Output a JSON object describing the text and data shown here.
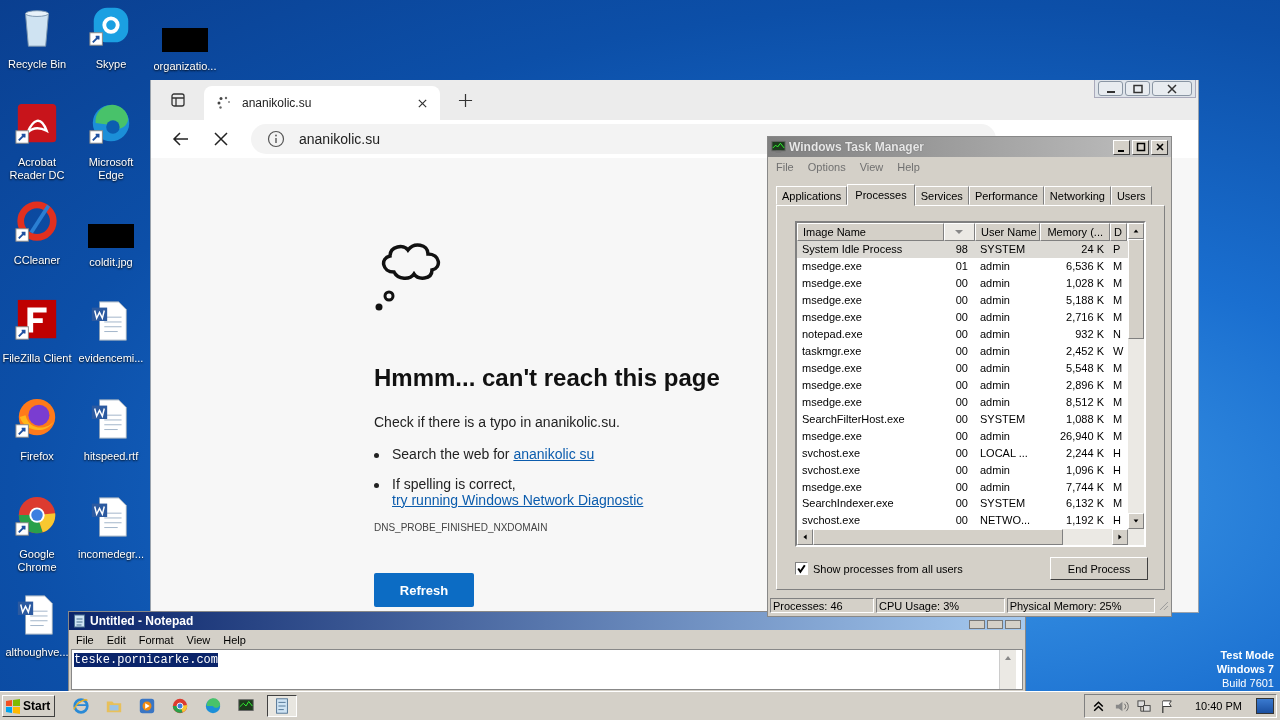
{
  "desktop": {
    "icon_columns": [
      [
        {
          "label": "Recycle Bin",
          "kind": "recycle",
          "shortcut": false
        },
        {
          "label": "Acrobat Reader DC",
          "kind": "acrobat",
          "shortcut": true
        },
        {
          "label": "CCleaner",
          "kind": "ccleaner",
          "shortcut": true
        },
        {
          "label": "FileZilla Client",
          "kind": "filezilla",
          "shortcut": true
        },
        {
          "label": "Firefox",
          "kind": "firefox",
          "shortcut": true
        },
        {
          "label": "Google Chrome",
          "kind": "chrome",
          "shortcut": true
        },
        {
          "label": "althoughve...",
          "kind": "word",
          "shortcut": false
        }
      ],
      [
        {
          "label": "Skype",
          "kind": "skype",
          "shortcut": true
        },
        {
          "label": "Microsoft Edge",
          "kind": "edge",
          "shortcut": true
        },
        {
          "label": "coldit.jpg",
          "kind": "redacted"
        },
        {
          "label": "evidencemi...",
          "kind": "word",
          "shortcut": false
        },
        {
          "label": "hitspeed.rtf",
          "kind": "word",
          "shortcut": false
        },
        {
          "label": "incomedegr...",
          "kind": "word",
          "shortcut": false
        }
      ],
      [
        {
          "label": "organizatio...",
          "kind": "redacted"
        }
      ]
    ],
    "os_notice": [
      "Test Mode",
      "Windows 7",
      "Build 7601"
    ]
  },
  "browser": {
    "tab_title": "ananikolic.su",
    "address": "ananikolic.su",
    "error": {
      "heading": "Hmmm... can't reach this page",
      "hint": "Check if there is a typo in ananikolic.su.",
      "suggestions": [
        {
          "text": "Search the web for",
          "link": "ananikolic su"
        },
        {
          "text": "If spelling is correct,",
          "link": "try running Windows Network Diagnostic"
        }
      ],
      "code": "DNS_PROBE_FINISHED_NXDOMAIN",
      "button": "Refresh"
    }
  },
  "task_manager": {
    "title": "Windows Task Manager",
    "menu": [
      "File",
      "Options",
      "View",
      "Help"
    ],
    "tabs": [
      {
        "label": "Applications",
        "selected": false
      },
      {
        "label": "Processes",
        "selected": true
      },
      {
        "label": "Services",
        "selected": false
      },
      {
        "label": "Performance",
        "selected": false
      },
      {
        "label": "Networking",
        "selected": false
      },
      {
        "label": "Users",
        "selected": false
      }
    ],
    "columns": [
      {
        "label": "Image Name",
        "sorted": false
      },
      {
        "sorted": true
      },
      {
        "label": "User Name",
        "sorted": false
      },
      {
        "label": "Memory (...",
        "sorted": false
      },
      {
        "label": "D",
        "sorted": false
      }
    ],
    "rows": [
      {
        "cells": [
          "System Idle Process",
          "98",
          "SYSTEM",
          "24 K",
          "P"
        ],
        "selected": true
      },
      {
        "cells": [
          "msedge.exe",
          "01",
          "admin",
          "6,536 K",
          "M"
        ],
        "selected": false
      },
      {
        "cells": [
          "msedge.exe",
          "00",
          "admin",
          "1,028 K",
          "M"
        ],
        "selected": false
      },
      {
        "cells": [
          "msedge.exe",
          "00",
          "admin",
          "5,188 K",
          "M"
        ],
        "selected": false
      },
      {
        "cells": [
          "msedge.exe",
          "00",
          "admin",
          "2,716 K",
          "M"
        ],
        "selected": false
      },
      {
        "cells": [
          "notepad.exe",
          "00",
          "admin",
          "932 K",
          "N"
        ],
        "selected": false
      },
      {
        "cells": [
          "taskmgr.exe",
          "00",
          "admin",
          "2,452 K",
          "W"
        ],
        "selected": false
      },
      {
        "cells": [
          "msedge.exe",
          "00",
          "admin",
          "5,548 K",
          "M"
        ],
        "selected": false
      },
      {
        "cells": [
          "msedge.exe",
          "00",
          "admin",
          "2,896 K",
          "M"
        ],
        "selected": false
      },
      {
        "cells": [
          "msedge.exe",
          "00",
          "admin",
          "8,512 K",
          "M"
        ],
        "selected": false
      },
      {
        "cells": [
          "SearchFilterHost.exe",
          "00",
          "SYSTEM",
          "1,088 K",
          "M"
        ],
        "selected": false
      },
      {
        "cells": [
          "msedge.exe",
          "00",
          "admin",
          "26,940 K",
          "M"
        ],
        "selected": false
      },
      {
        "cells": [
          "svchost.exe",
          "00",
          "LOCAL ...",
          "2,244 K",
          "H"
        ],
        "selected": false
      },
      {
        "cells": [
          "svchost.exe",
          "00",
          "admin",
          "1,096 K",
          "H"
        ],
        "selected": false
      },
      {
        "cells": [
          "msedge.exe",
          "00",
          "admin",
          "7,744 K",
          "M"
        ],
        "selected": false
      },
      {
        "cells": [
          "SearchIndexer.exe",
          "00",
          "SYSTEM",
          "6,132 K",
          "M"
        ],
        "selected": false
      },
      {
        "cells": [
          "svchost.exe",
          "00",
          "NETWO...",
          "1,192 K",
          "H"
        ],
        "selected": false
      }
    ],
    "show_all": {
      "label": "Show processes from all users",
      "checked": true
    },
    "end_button": "End Process",
    "status": [
      "Processes: 46",
      "CPU Usage: 3%",
      "Physical Memory: 25%"
    ]
  },
  "notepad": {
    "title": "Untitled - Notepad",
    "menu": [
      "File",
      "Edit",
      "Format",
      "View",
      "Help"
    ],
    "text": "teske.pornicarke.com",
    "text_selected": true
  },
  "taskbar": {
    "start": "Start",
    "items": [
      {
        "kind": "ie",
        "active": false
      },
      {
        "kind": "folder",
        "active": false
      },
      {
        "kind": "media",
        "active": false
      },
      {
        "kind": "chrome",
        "active": false
      },
      {
        "kind": "edge",
        "active": false
      },
      {
        "kind": "taskmgr",
        "active": false
      },
      {
        "kind": "notepad",
        "active": true
      }
    ],
    "time": "10:40 PM"
  }
}
